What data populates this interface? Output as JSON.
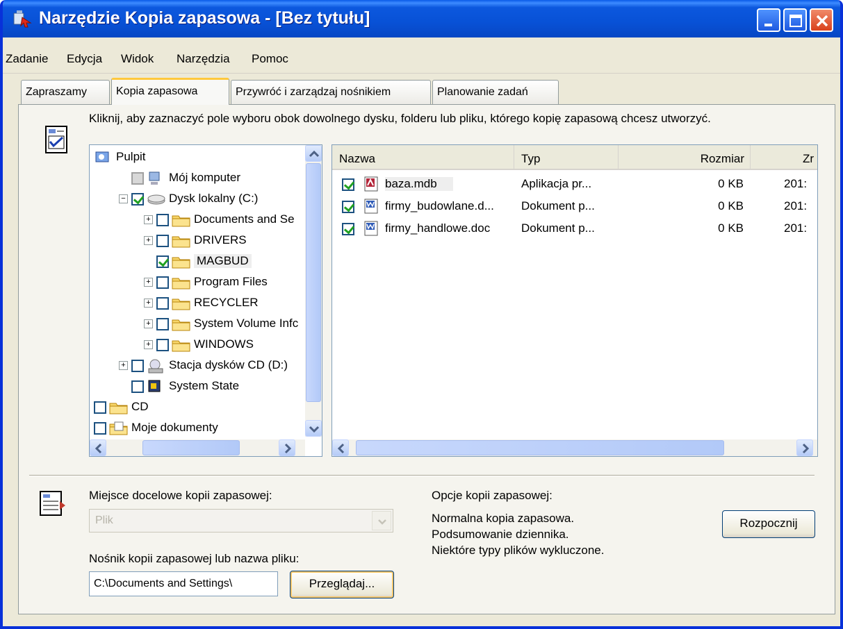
{
  "window": {
    "title": "Narzędzie Kopia zapasowa - [Bez tytułu]"
  },
  "menu": [
    "Zadanie",
    "Edycja",
    "Widok",
    "Narzędzia",
    "Pomoc"
  ],
  "tabs": [
    {
      "label": "Zapraszamy",
      "active": false
    },
    {
      "label": "Kopia zapasowa",
      "active": true
    },
    {
      "label": "Przywróć i zarządzaj nośnikiem",
      "active": false
    },
    {
      "label": "Planowanie zadań",
      "active": false
    }
  ],
  "instruction": "Kliknij, aby zaznaczyć pole wyboru obok dowolnego dysku, folderu lub pliku, którego kopię zapasową chcesz utworzyć.",
  "tree": [
    {
      "label": "Pulpit",
      "icon": "desktop-icon",
      "checkbox": "none",
      "expander": "none"
    },
    {
      "label": "Mój komputer",
      "icon": "computer-icon",
      "checkbox": "gray",
      "expander": "none"
    },
    {
      "label": "Dysk lokalny (C:)",
      "icon": "drive-icon",
      "checkbox": "checked",
      "expander": "minus"
    },
    {
      "label": "Documents and Se",
      "icon": "folder-icon",
      "checkbox": "unchecked",
      "expander": "plus"
    },
    {
      "label": "DRIVERS",
      "icon": "folder-icon",
      "checkbox": "unchecked",
      "expander": "plus"
    },
    {
      "label": "MAGBUD",
      "icon": "folder-icon",
      "checkbox": "checked",
      "expander": "none"
    },
    {
      "label": "Program Files",
      "icon": "folder-icon",
      "checkbox": "unchecked",
      "expander": "plus"
    },
    {
      "label": "RECYCLER",
      "icon": "folder-icon",
      "checkbox": "unchecked",
      "expander": "plus"
    },
    {
      "label": "System Volume Infc",
      "icon": "folder-icon",
      "checkbox": "unchecked",
      "expander": "plus"
    },
    {
      "label": "WINDOWS",
      "icon": "folder-icon",
      "checkbox": "unchecked",
      "expander": "plus"
    },
    {
      "label": "Stacja dysków CD (D:)",
      "icon": "cd-drive-icon",
      "checkbox": "unchecked",
      "expander": "plus"
    },
    {
      "label": "System State",
      "icon": "system-state-icon",
      "checkbox": "unchecked",
      "expander": "none"
    },
    {
      "label": "CD",
      "icon": "folder-icon",
      "checkbox": "unchecked",
      "expander": "none"
    },
    {
      "label": "Moje dokumenty",
      "icon": "documents-folder-icon",
      "checkbox": "unchecked",
      "expander": "none"
    }
  ],
  "list": {
    "columns": [
      "Nazwa",
      "Typ",
      "Rozmiar",
      "Zr"
    ],
    "rows": [
      {
        "name": "baza.mdb",
        "type": "Aplikacja pr...",
        "size": "0 KB",
        "modified": "201:",
        "icon": "access-db-icon",
        "checked": true
      },
      {
        "name": "firmy_budowlane.d...",
        "type": "Dokument p...",
        "size": "0 KB",
        "modified": "201:",
        "icon": "word-doc-icon",
        "checked": true
      },
      {
        "name": "firmy_handlowe.doc",
        "type": "Dokument p...",
        "size": "0 KB",
        "modified": "201:",
        "icon": "word-doc-icon",
        "checked": true
      }
    ]
  },
  "destination": {
    "label": "Miejsce docelowe kopii zapasowej:",
    "value": "Plik"
  },
  "media": {
    "label": "Nośnik kopii zapasowej lub nazwa pliku:",
    "value": "C:\\Documents and Settings\\",
    "browse_label": "Przeglądaj..."
  },
  "options": {
    "heading": "Opcje kopii zapasowej:",
    "lines": [
      "Normalna kopia zapasowa.",
      "Podsumowanie dziennika.",
      "Niektóre typy plików wykluczone."
    ]
  },
  "start_label": "Rozpocznij",
  "colors": {
    "titlebar": "#0851d6",
    "window_bg": "#ece9d8",
    "selection": "#eeeeee",
    "border": "#7f9db9"
  }
}
